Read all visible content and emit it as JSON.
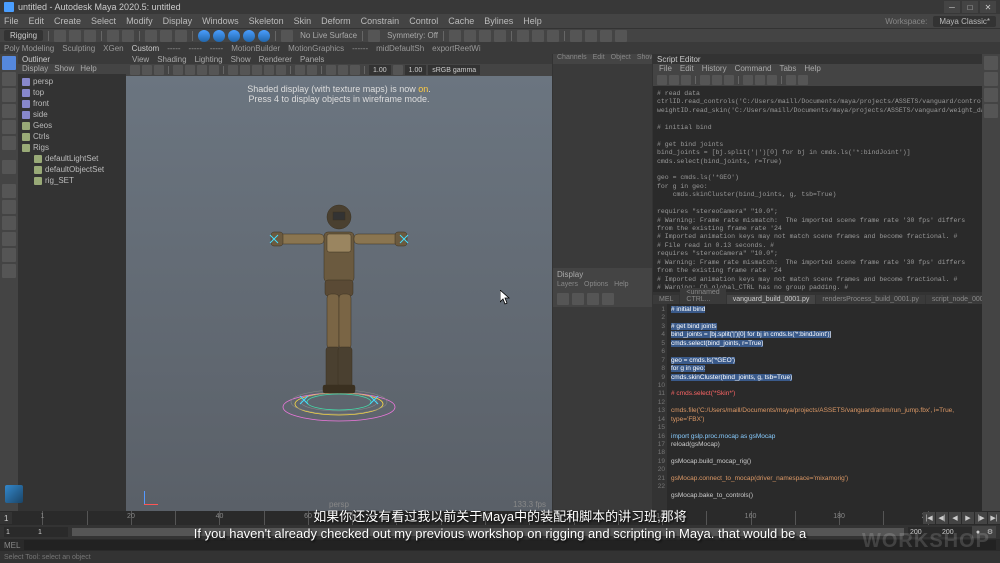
{
  "titlebar": {
    "title": "untitled - Autodesk Maya 2020.5: untitled"
  },
  "menubar": {
    "items": [
      "File",
      "Edit",
      "Create",
      "Select",
      "Modify",
      "Display",
      "Windows",
      "Skeleton",
      "Skin",
      "Deform",
      "Constrain",
      "Control",
      "Cache",
      "Bylines",
      "Help"
    ],
    "workspace_label": "Workspace:",
    "workspace_value": "Maya Classic*"
  },
  "shelf": {
    "dropdown": "Rigging",
    "no_live": "No Live Surface",
    "symmetry": "Symmetry: Off"
  },
  "tabbar": {
    "items": [
      "Poly Modeling",
      "Sculpting",
      "XGen",
      "Custom",
      "-----",
      "-----",
      "-----",
      "MotionBuilder",
      "MotionGraphics",
      "------",
      "midDefaultSh",
      "exportReetWi"
    ]
  },
  "outliner": {
    "title": "Outliner",
    "menu": [
      "Display",
      "Show",
      "Help"
    ],
    "items": [
      {
        "label": "persp",
        "icon": "cam"
      },
      {
        "label": "top",
        "icon": "cam"
      },
      {
        "label": "front",
        "icon": "cam"
      },
      {
        "label": "side",
        "icon": "cam"
      },
      {
        "label": "Geos",
        "icon": "grp"
      },
      {
        "label": "Ctrls",
        "icon": "grp"
      },
      {
        "label": "Rigs",
        "icon": "grp"
      },
      {
        "label": "defaultLightSet",
        "icon": "grp",
        "indent": true
      },
      {
        "label": "defaultObjectSet",
        "icon": "grp",
        "indent": true
      },
      {
        "label": "rig_SET",
        "icon": "grp",
        "indent": true
      }
    ]
  },
  "viewport": {
    "menu": [
      "View",
      "Shading",
      "Lighting",
      "Show",
      "Renderer",
      "Panels"
    ],
    "msg_line1_a": "Shaded display (with texture maps) is now ",
    "msg_line1_b": "on",
    "msg_line1_c": ".",
    "msg_line2": "Press 4 to display objects in wireframe mode.",
    "persp": "persp",
    "fps": "133.3 fps",
    "toolbar_val": "1.00",
    "toolbar_cs": "sRGB gamma"
  },
  "mid_panel": {
    "tabs": [
      "Channels",
      "Edit",
      "Object",
      "Show"
    ],
    "display": "Display",
    "layers_menu": [
      "Layers",
      "Options",
      "Help"
    ]
  },
  "script_editor": {
    "title": "Script Editor",
    "menu": [
      "File",
      "Edit",
      "History",
      "Command",
      "Tabs",
      "Help"
    ],
    "output": "# read data\nctrlID.read_controls('C:/Users/maill/Documents/maya/projects/ASSETS/vanguard/control_data/control_curves.json')\nweightID.read_skin('C:/Users/maill/Documents/maya/projects/ASSETS/vanguard/weight_data/')\n\n# initial bind\n\n# get bind joints\nbind_joints = [bj.split('|')[0] for bj in cmds.ls('*:bindJoint')]\ncmds.select(bind_joints, r=True)\n\ngeo = cmds.ls('*GEO')\nfor g in geo:\n    cmds.skinCluster(bind_joints, g, tsb=True)\n\nrequires \"stereoCamera\" \"10.0\";\n# Warning: Frame rate mismatch:  The imported scene frame rate '30 fps' differs from the existing frame rate '24\n# Imported animation keys may not match scene frames and become fractional. #\n# File read in 0.13 seconds. #\nrequires \"stereoCamera\" \"10.0\";\n# Warning: Frame rate mismatch:  The imported scene frame rate '30 fps' differs from the existing frame rate '24\n# Imported animation keys may not match scene frames and become fractional. #\n# Warning: CG_global_CTRL has no group padding. #\n# Warning: color_CTRL has no group padding. #\n# Warning: switch_CTRL has no group padding. #\n# Warning: visibility_CTRL has no group padding. #\n# select -cl  ;",
    "tabs": [
      {
        "label": "MEL",
        "active": false
      },
      {
        "label": "<unnamed   CTRL...",
        "active": false
      },
      {
        "label": "vanguard_build_0001.py",
        "active": true
      },
      {
        "label": "rendersProcess_build_0001.py",
        "active": false
      },
      {
        "label": "script_node_0001.py",
        "active": false
      },
      {
        "label": "Python",
        "active": false
      }
    ],
    "code_lines": [
      {
        "n": 1,
        "sel": "# initial bind",
        "cls": "c-sel"
      },
      {
        "n": 2,
        "txt": ""
      },
      {
        "n": 3,
        "sel": "# get bind joints",
        "cls": "c-sel"
      },
      {
        "n": 4,
        "sel": "bind_joints = [bj.split('|')[0] for bj in cmds.ls('*:bindJoint')]",
        "cls": "c-sel"
      },
      {
        "n": 5,
        "sel": "cmds.select(bind_joints, r=True)",
        "cls": "c-sel"
      },
      {
        "n": 6,
        "txt": ""
      },
      {
        "n": 7,
        "sel": "geo = cmds.ls('*GEO')",
        "cls": "c-sel"
      },
      {
        "n": 8,
        "sel": "for g in geo:",
        "cls": "c-sel"
      },
      {
        "n": 9,
        "sel": "    cmds.skinCluster(bind_joints, g, tsb=True)",
        "cls": "c-sel"
      },
      {
        "n": 10,
        "txt": ""
      },
      {
        "n": 11,
        "txt": "# cmds.select('*Skin*')",
        "cls": "c-red"
      },
      {
        "n": 12,
        "txt": ""
      },
      {
        "n": 13,
        "txt": "cmds.file('C:/Users/maill/Documents/maya/projects/ASSETS/vanguard/anim/run_jump.fbx', i=True, type='FBX')",
        "cls": "c-str"
      },
      {
        "n": 14,
        "txt": ""
      },
      {
        "n": 15,
        "txt": "import gslp.proc.mocap as gsMocap",
        "cls": "c-kw"
      },
      {
        "n": 16,
        "txt": "reload(gsMocap)"
      },
      {
        "n": 17,
        "txt": ""
      },
      {
        "n": 18,
        "txt": "gsMocap.build_mocap_rig()"
      },
      {
        "n": 19,
        "txt": ""
      },
      {
        "n": 20,
        "txt": "gsMocap.connect_to_mocap(driver_namespace='mixamorig')",
        "cls": "c-str"
      },
      {
        "n": 21,
        "txt": ""
      },
      {
        "n": 22,
        "txt": "gsMocap.bake_to_controls()"
      }
    ]
  },
  "timeline": {
    "current": "1",
    "range_start": "1",
    "range_end": "200",
    "anim_start": "1",
    "anim_end": "200",
    "mel": "MEL",
    "status": "Select Tool: select an object"
  },
  "subtitles": {
    "zh": "如果你还没有看过我以前关于Maya中的装配和脚本的讲习班,那将",
    "en": "If you haven't already checked out my previous workshop on rigging and scripting in Maya. that would be a"
  },
  "watermark": "WORKSHOP"
}
